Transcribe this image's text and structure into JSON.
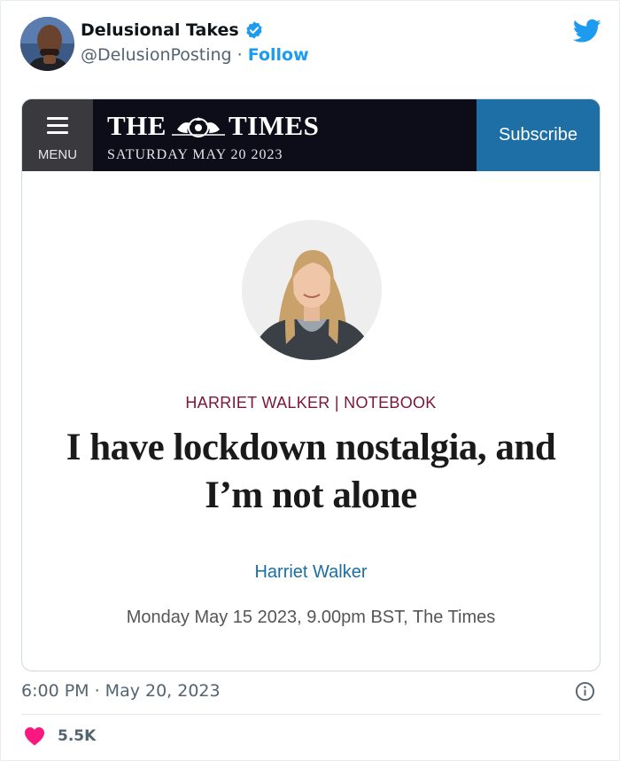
{
  "tweet": {
    "display_name": "Delusional Takes",
    "handle": "@DelusionPosting",
    "separator": "·",
    "follow_label": "Follow",
    "timestamp": "6:00 PM · May 20, 2023",
    "like_count": "5.5K",
    "brand_color": "#1d9bf0",
    "like_color": "#f91880"
  },
  "card": {
    "menu_label": "MENU",
    "brand_left": "THE",
    "brand_right": "TIMES",
    "brand_date": "SATURDAY MAY 20 2023",
    "subscribe_label": "Subscribe",
    "byline_top": "HARRIET WALKER | NOTEBOOK",
    "headline": "I have lockdown nostalgia, and I’m not alone",
    "author": "Harriet Walker",
    "dateline": "Monday May 15 2023, 9.00pm BST, The Times"
  },
  "icons": [
    "verified-badge-icon",
    "twitter-bird-icon",
    "menu-icon",
    "times-crest-icon",
    "info-icon",
    "heart-icon"
  ]
}
